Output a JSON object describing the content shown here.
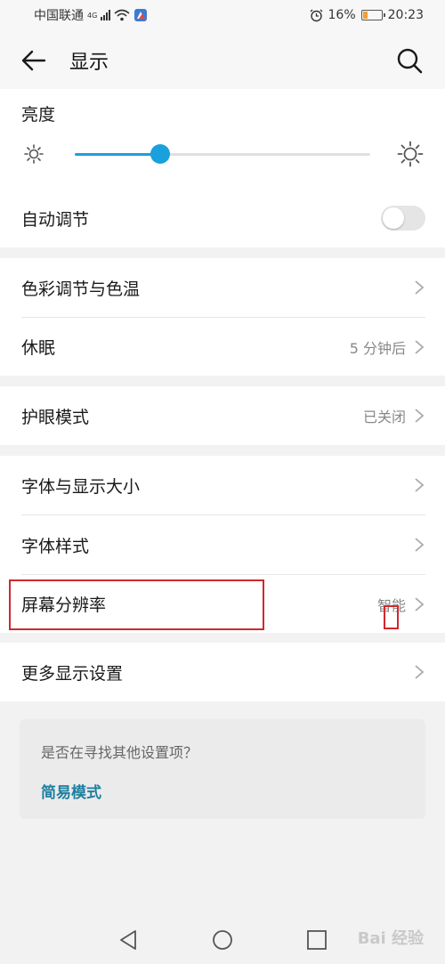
{
  "status_bar": {
    "carrier": "中国联通",
    "network": "4G",
    "battery_percent": "16%",
    "time": "20:23",
    "icons": [
      "signal-icon",
      "wifi-icon",
      "app-icon",
      "alarm-icon",
      "battery-icon"
    ]
  },
  "header": {
    "title": "显示",
    "back_icon": "arrow-left-icon",
    "search_icon": "search-icon"
  },
  "brightness": {
    "label": "亮度",
    "level": 0.29,
    "auto_label": "自动调节",
    "auto_enabled": false
  },
  "sections": [
    {
      "label": "色彩调节与色温",
      "value": ""
    },
    {
      "label": "休眠",
      "value": "5 分钟后"
    },
    {
      "label": "护眼模式",
      "value": "已关闭"
    },
    {
      "label": "字体与显示大小",
      "value": ""
    },
    {
      "label": "字体样式",
      "value": ""
    },
    {
      "label": "屏幕分辨率",
      "value": "智能"
    },
    {
      "label": "更多显示设置",
      "value": ""
    }
  ],
  "hint": {
    "text": "是否在寻找其他设置项？",
    "link": "简易模式"
  },
  "colors": {
    "accent": "#1aa0dc",
    "link": "#1e7fa0",
    "annotation": "#d0282e"
  },
  "watermark": "Bai 经验"
}
